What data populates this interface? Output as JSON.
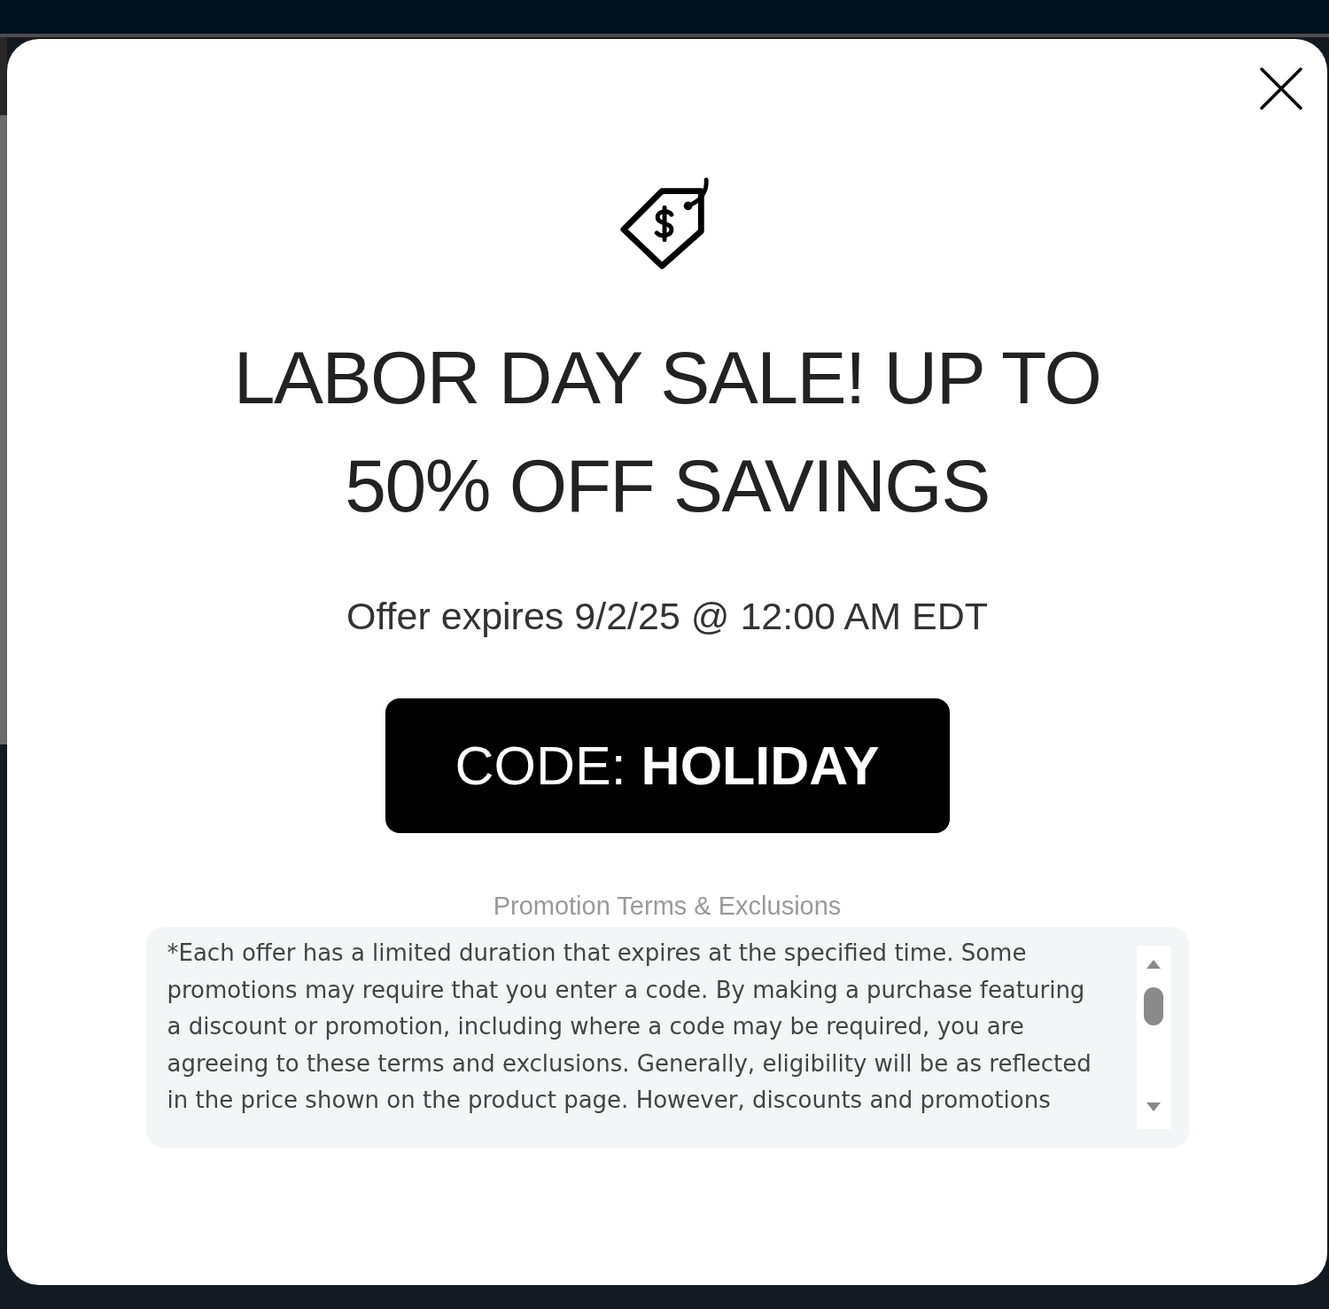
{
  "dialog": {
    "headline": "LABOR DAY SALE! UP TO 50% OFF SAVINGS",
    "expiry": "Offer expires 9/2/25 @ 12:00 AM EDT",
    "code_button": "CODE: **HOLIDAY**",
    "terms": {
      "title": "Promotion Terms & Exclusions",
      "text": "*Each offer has a limited duration that expires at the specified time. Some promotions may require that you enter a code. By making a purchase featuring a discount or promotion, including where a code may be required, you are agreeing to these terms and exclusions. Generally, eligibility will be as reflected in the price shown on the product page. However, discounts and promotions"
    }
  }
}
